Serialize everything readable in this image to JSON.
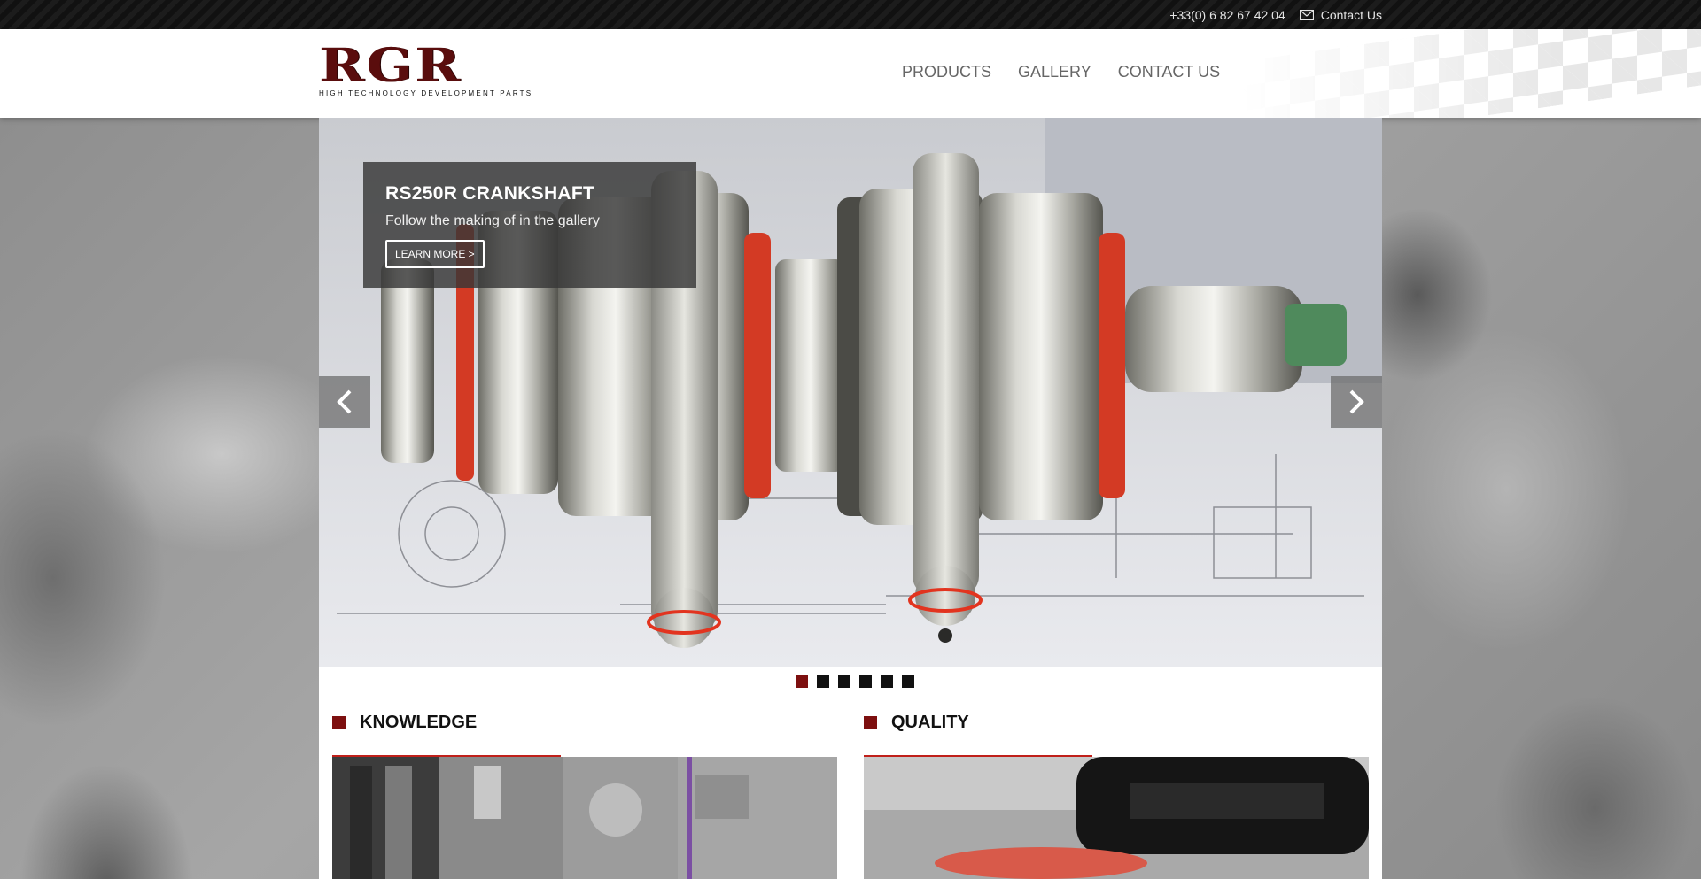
{
  "topbar": {
    "phone": "+33(0) 6 82 67 42 04",
    "contact_label": "Contact Us",
    "contact_icon": "mail-icon"
  },
  "header": {
    "logo_text": "RGR",
    "logo_tagline": "HIGH TECHNOLOGY DEVELOPMENT PARTS",
    "nav": [
      {
        "label": "PRODUCTS"
      },
      {
        "label": "GALLERY"
      },
      {
        "label": "CONTACT US"
      }
    ]
  },
  "slider": {
    "title": "RS250R CRANKSHAFT",
    "subtitle": "Follow the making of in the gallery",
    "button_label": "LEARN MORE >",
    "prev_icon": "chevron-left-icon",
    "next_icon": "chevron-right-icon",
    "slide_count": 6,
    "active_slide": 1
  },
  "sections": [
    {
      "title": "KNOWLEDGE",
      "icon": "square-icon"
    },
    {
      "title": "QUALITY",
      "icon": "square-icon"
    }
  ],
  "colors": {
    "brand_red": "#7d0f0f",
    "accent_line": "#c0201a"
  }
}
